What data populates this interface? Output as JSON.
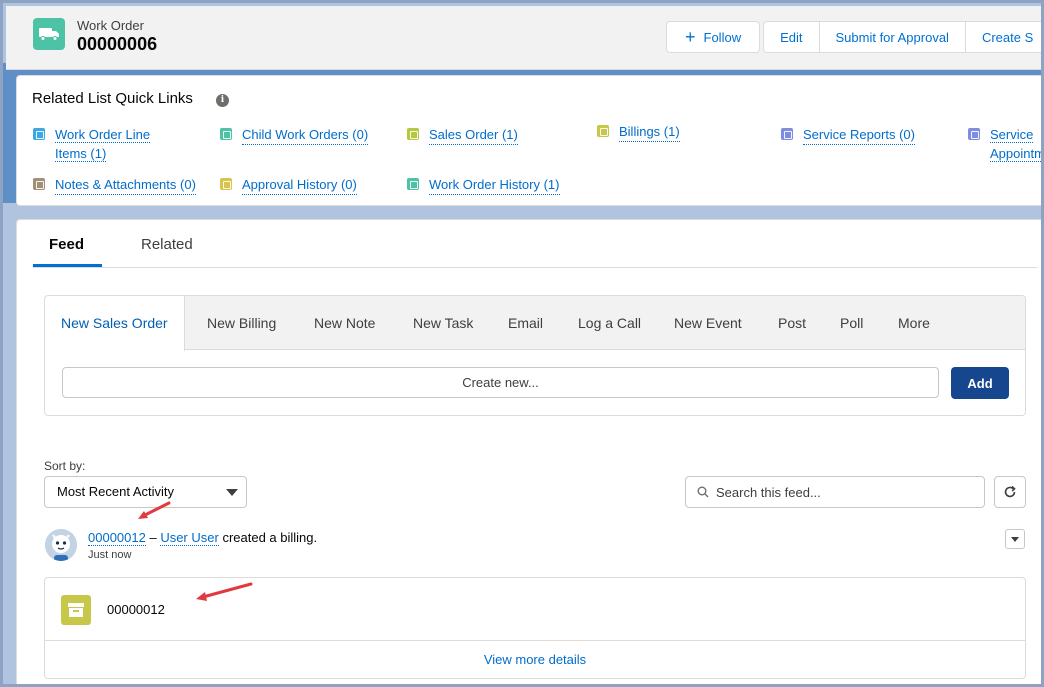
{
  "header": {
    "object_label": "Work Order",
    "record_number": "00000006",
    "buttons": {
      "follow": "Follow",
      "edit": "Edit",
      "submit": "Submit for Approval",
      "create": "Create S"
    }
  },
  "quick_links": {
    "title": "Related List Quick Links",
    "items": [
      {
        "line1": "Work Order Line",
        "line2": "Items (1)",
        "color": "#3ba7e5"
      },
      {
        "label": "Child Work Orders (0)",
        "color": "#4bc3a4"
      },
      {
        "label": "Sales Order (1)",
        "color": "#b5c840"
      },
      {
        "label": "Billings (1)",
        "color": "#c7c74a"
      },
      {
        "label": "Service Reports (0)",
        "color": "#7f8de1"
      },
      {
        "line1": "Service",
        "line2": "Appointm",
        "color": "#7f8de1"
      },
      {
        "label": "Notes & Attachments (0)",
        "color": "#a09176"
      },
      {
        "label": "Approval History (0)",
        "color": "#d9c34b"
      },
      {
        "label": "Work Order History (1)",
        "color": "#4bc3a4"
      }
    ]
  },
  "tabs": {
    "feed": "Feed",
    "related": "Related"
  },
  "publisher": {
    "tabs": [
      "New Sales Order",
      "New Billing",
      "New Note",
      "New Task",
      "Email",
      "Log a Call",
      "New Event",
      "Post",
      "Poll",
      "More"
    ],
    "create_placeholder": "Create new...",
    "add_label": "Add"
  },
  "feed": {
    "sort_label": "Sort by:",
    "sort_value": "Most Recent Activity",
    "search_placeholder": "Search this feed...",
    "item": {
      "record_link": "00000012",
      "separator": " – ",
      "user_link": "User User",
      "action_text": " created a billing.",
      "time": "Just now",
      "billing_name": "00000012",
      "view_more": "View more details"
    }
  },
  "colors": {
    "brand_blue": "#0070d2",
    "add_button": "#16478e",
    "arrow": "#e0393e"
  }
}
